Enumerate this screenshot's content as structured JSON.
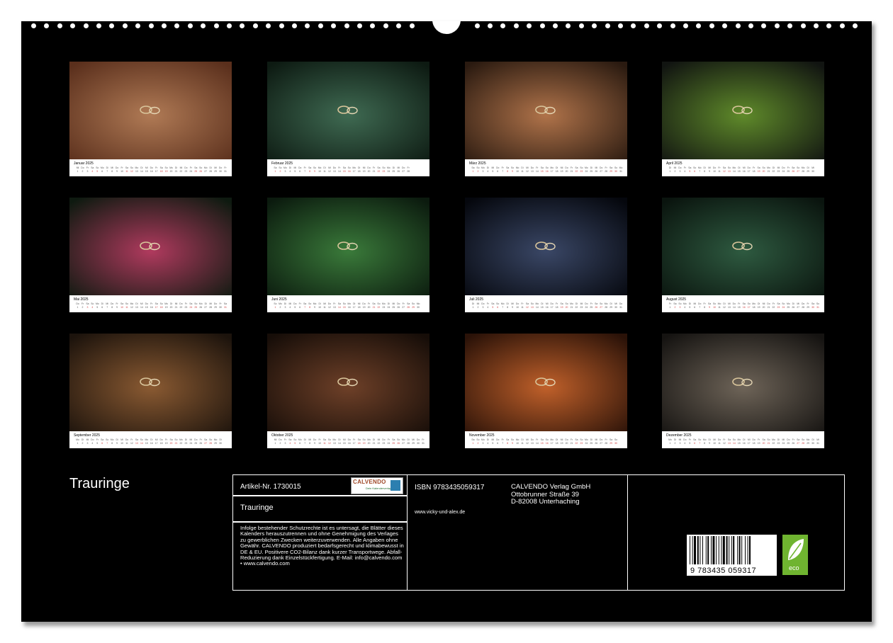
{
  "calendar": {
    "months": [
      {
        "label": "Januar 2025",
        "days": 31,
        "start": 2
      },
      {
        "label": "Februar 2025",
        "days": 28,
        "start": 5
      },
      {
        "label": "März 2025",
        "days": 31,
        "start": 5
      },
      {
        "label": "April 2025",
        "days": 30,
        "start": 1
      },
      {
        "label": "Mai 2025",
        "days": 31,
        "start": 3
      },
      {
        "label": "Juni 2025",
        "days": 30,
        "start": 6
      },
      {
        "label": "Juli 2025",
        "days": 31,
        "start": 1
      },
      {
        "label": "August 2025",
        "days": 31,
        "start": 4
      },
      {
        "label": "September 2025",
        "days": 30,
        "start": 0
      },
      {
        "label": "Oktober 2025",
        "days": 31,
        "start": 2
      },
      {
        "label": "November 2025",
        "days": 30,
        "start": 5
      },
      {
        "label": "Dezember 2025",
        "days": 31,
        "start": 0
      }
    ],
    "weekdays": [
      "Mo",
      "Di",
      "Mi",
      "Do",
      "Fr",
      "Sa",
      "So"
    ],
    "photo_colors": [
      {
        "a": "#5a2f1c",
        "b": "#b07a55"
      },
      {
        "a": "#0d1a12",
        "b": "#3f6a52"
      },
      {
        "a": "#2a1a10",
        "b": "#b0734a"
      },
      {
        "a": "#111411",
        "b": "#5f8a2a"
      },
      {
        "a": "#0e1a10",
        "b": "#b03a5e"
      },
      {
        "a": "#0b1a0e",
        "b": "#3a7a3a"
      },
      {
        "a": "#05070d",
        "b": "#3a4766"
      },
      {
        "a": "#0a140e",
        "b": "#2e5a40"
      },
      {
        "a": "#1c130c",
        "b": "#8a5a32"
      },
      {
        "a": "#160d08",
        "b": "#6e4028"
      },
      {
        "a": "#2a1208",
        "b": "#c0602a"
      },
      {
        "a": "#151311",
        "b": "#6e6458"
      }
    ]
  },
  "footer": {
    "title": "Trauringe",
    "article": "Artikel-Nr. 1730015",
    "logo_text": "CALVENDO",
    "logo_sub": "Dein Kalenderverlag",
    "product_title": "Trauringe",
    "legal": "Infolge bestehender Schutzrechte ist es untersagt, die Blätter dieses Kalenders herauszutrennen und ohne Genehmigung des Verlages zu gewerblichen Zwecken weiterzuverwenden. Alle Angaben ohne Gewähr. CALVENDO produziert bedarfsgerecht und klimabewusst in DE & EU. Positivere CO2-Bilanz dank kurzer Transportwege. Abfall-Reduzierung dank Einzelstückfertigung. E-Mail: info@calvendo.com • www.calvendo.com",
    "isbn": "ISBN 9783435059317",
    "website": "www.vicky-und-alex.de",
    "publisher": [
      "CALVENDO Verlag GmbH",
      "Ottobrunner Straße 39",
      "D-82008 Unterhaching"
    ],
    "barcode_number": "9 783435 059317",
    "eco_label": "eco"
  }
}
